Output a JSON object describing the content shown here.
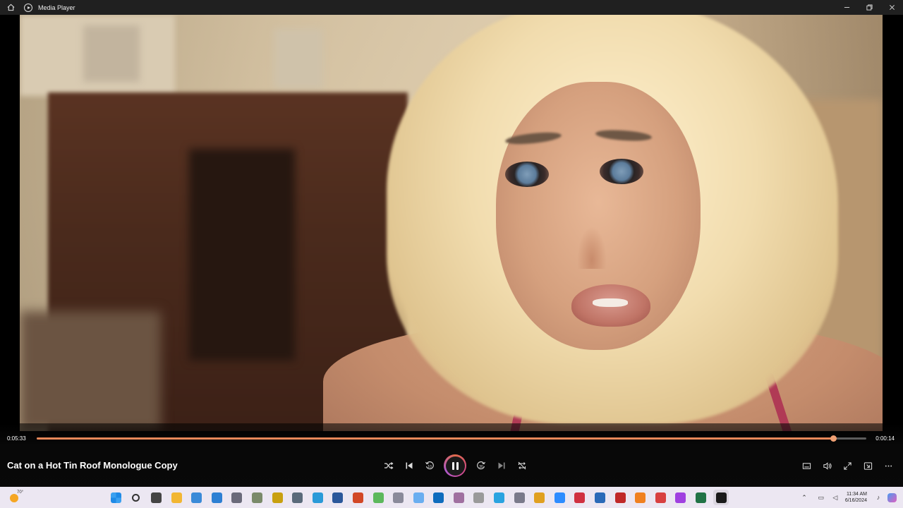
{
  "window": {
    "title": "Media Player",
    "controls": [
      "minimize",
      "maximize",
      "close"
    ]
  },
  "player": {
    "media_title": "Cat on a Hot Tin Roof Monologue Copy",
    "elapsed": "0:05:33",
    "remaining": "0:00:14",
    "progress_fraction": 0.96,
    "state": "playing",
    "accent_color": "#e8885a"
  },
  "transport": {
    "shuffle_icon": "shuffle-icon",
    "previous_icon": "previous-icon",
    "skip_back_label": "10",
    "skip_forward_label": "30",
    "next_icon": "next-icon",
    "repeat_icon": "repeat-off-icon"
  },
  "taskbar": {
    "weather_temp": "70°",
    "clock_time": "11:34 AM",
    "clock_date": "6/16/2024",
    "apps": [
      {
        "name": "start-icon",
        "color": "#1f6fd6"
      },
      {
        "name": "search-icon",
        "color": "#333333"
      },
      {
        "name": "task-view-icon",
        "color": "#444444"
      },
      {
        "name": "file-explorer-icon",
        "color": "#f2b632"
      },
      {
        "name": "photos-app-icon",
        "color": "#3a8ad8"
      },
      {
        "name": "pen-app-icon",
        "color": "#2d7fd3"
      },
      {
        "name": "settings-icon",
        "color": "#6a6a7a"
      },
      {
        "name": "scanner-app-icon",
        "color": "#7a8a6a"
      },
      {
        "name": "imdb-star-icon",
        "color": "#c8a010"
      },
      {
        "name": "camera-app-icon",
        "color": "#5a6a7a"
      },
      {
        "name": "browser-app-icon",
        "color": "#2a9ad8"
      },
      {
        "name": "word-icon",
        "color": "#2b579a"
      },
      {
        "name": "powerpoint-icon",
        "color": "#d24726"
      },
      {
        "name": "green-app-icon",
        "color": "#5cb85c"
      },
      {
        "name": "microphone-app-icon",
        "color": "#8a8a9a"
      },
      {
        "name": "onedrive-icon",
        "color": "#6aaef0"
      },
      {
        "name": "cloud-app-icon",
        "color": "#0f6cbd"
      },
      {
        "name": "feather-app-icon",
        "color": "#a070a0"
      },
      {
        "name": "dots-app-icon",
        "color": "#9a9a9a"
      },
      {
        "name": "telegram-icon",
        "color": "#2aa3e0"
      },
      {
        "name": "music-app-icon",
        "color": "#7a7a8a"
      },
      {
        "name": "chrome-icon",
        "color": "#e0a020"
      },
      {
        "name": "zoom-icon",
        "color": "#2d8cff"
      },
      {
        "name": "shield-app-icon",
        "color": "#d03040"
      },
      {
        "name": "store-app-icon",
        "color": "#2a6ab8"
      },
      {
        "name": "red-app-icon",
        "color": "#c02828"
      },
      {
        "name": "orange-app-icon",
        "color": "#f08020"
      },
      {
        "name": "red-circle-app-icon",
        "color": "#d84040"
      },
      {
        "name": "messenger-icon",
        "color": "#a040e0"
      },
      {
        "name": "excel-icon",
        "color": "#217346"
      },
      {
        "name": "media-player-icon",
        "color": "#1a1a1a"
      }
    ]
  }
}
